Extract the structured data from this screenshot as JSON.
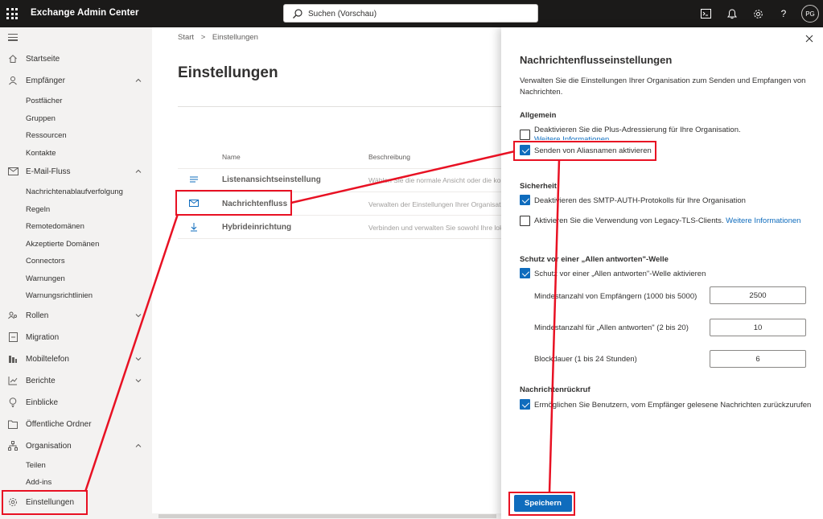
{
  "topbar": {
    "app_title": "Exchange Admin Center",
    "search_placeholder": "Suchen (Vorschau)",
    "avatar_initials": "PG",
    "help_glyph": "?",
    "icons": [
      "waffle-icon",
      "terminal-icon",
      "bell-icon",
      "gear-icon",
      "help-icon"
    ]
  },
  "nav": {
    "items": [
      {
        "label": "Startseite",
        "icon": "home-icon"
      },
      {
        "label": "Empfänger",
        "icon": "person-icon"
      },
      {
        "label": "E-Mail-Fluss",
        "icon": "mail-icon"
      },
      {
        "label": "Rollen",
        "icon": "roles-icon"
      },
      {
        "label": "Migration",
        "icon": "migration-icon"
      },
      {
        "label": "Mobiltelefon",
        "icon": "mobile-icon"
      },
      {
        "label": "Berichte",
        "icon": "chart-icon"
      },
      {
        "label": "Einblicke",
        "icon": "lightbulb-icon"
      },
      {
        "label": "Öffentliche Ordner",
        "icon": "folder-icon"
      },
      {
        "label": "Organisation",
        "icon": "org-icon"
      },
      {
        "label": "Einstellungen",
        "icon": "settings-icon"
      }
    ],
    "recipients_sub": [
      "Postfächer",
      "Gruppen",
      "Ressourcen",
      "Kontakte"
    ],
    "mailflow_sub": [
      "Nachrichtenablaufverfolgung",
      "Regeln",
      "Remotedomänen",
      "Akzeptierte Domänen",
      "Connectors",
      "Warnungen",
      "Warnungsrichtlinien"
    ],
    "org_sub": [
      "Teilen",
      "Add-ins"
    ]
  },
  "main": {
    "breadcrumb": [
      "Start",
      ">",
      "Einstellungen"
    ],
    "title": "Einstellungen",
    "columns": [
      "Name",
      "Beschreibung"
    ],
    "rows": [
      {
        "name": "Listenansichtseinstellung",
        "desc": "Wählen Sie die normale Ansicht oder die komp"
      },
      {
        "name": "Nachrichtenfluss",
        "desc": "Verwalten der Einstellungen Ihrer Organisation"
      },
      {
        "name": "Hybrideinrichtung",
        "desc": "Verbinden und verwalten Sie sowohl Ihre lokal"
      }
    ]
  },
  "panel": {
    "title": "Nachrichtenflusseinstellungen",
    "description": "Verwalten Sie die Einstellungen Ihrer Organisation zum Senden und Empfangen von Nachrichten.",
    "general": {
      "heading": "Allgemein",
      "plus_addressing": "Deaktivieren Sie die Plus-Adressierung für Ihre Organisation.",
      "plus_link": "Weitere Informationen",
      "alias_sending": "Senden von Aliasnamen aktivieren"
    },
    "security": {
      "heading": "Sicherheit",
      "smtp_auth": "Deaktivieren des SMTP-AUTH-Protokolls für Ihre Organisation",
      "legacy_tls": "Aktivieren Sie die Verwendung von Legacy-TLS-Clients.",
      "legacy_tls_link": "Weitere Informationen"
    },
    "reply_all": {
      "heading": "Schutz vor einer „Allen antworten\"-Welle",
      "enable": "Schutz vor einer „Allen antworten\"-Welle aktivieren",
      "min_recipients_label": "Mindestanzahl von Empfängern (1000 bis 5000)",
      "min_recipients_value": "2500",
      "min_replies_label": "Mindestanzahl für „Allen antworten\" (2 bis 20)",
      "min_replies_value": "10",
      "block_duration_label": "Blockdauer (1 bis 24 Stunden)",
      "block_duration_value": "6"
    },
    "recall": {
      "heading": "Nachrichtenrückruf",
      "enable": "Ermöglichen Sie Benutzern, vom Empfänger gelesene Nachrichten zurückzurufen"
    },
    "save_label": "Speichern"
  },
  "colors": {
    "accent": "#0f6cbd",
    "topbar": "#1b1a19",
    "nav_bg": "#f3f2f1",
    "annotation": "#e81123"
  }
}
